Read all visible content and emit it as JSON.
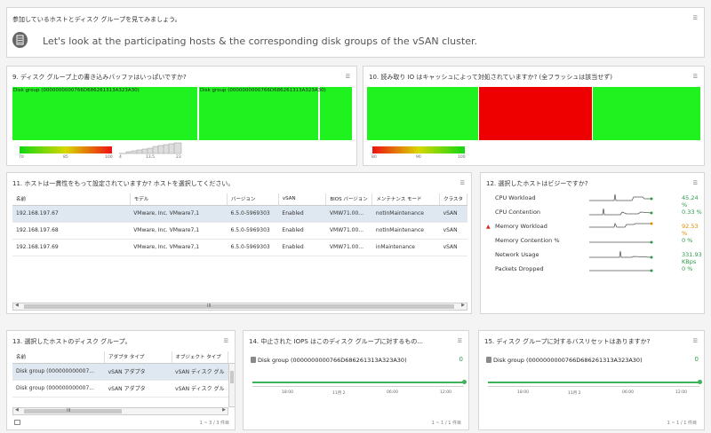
{
  "intro": {
    "title": "参加しているホストとディスク グループを見てみましょう。",
    "text": "Let's look at the participating hosts & the corresponding disk groups of the vSAN cluster."
  },
  "w9": {
    "title": "9. ディスク グループ上の書き込みバッファはいっぱいですか?",
    "groups": [
      "Disk group (0000000000766D686261313A323A30)",
      "Disk group (0000000000766D686261313A323A30)"
    ],
    "ticks": [
      "70",
      "85",
      "100"
    ],
    "hist_ticks": [
      "4",
      "13.5",
      "23"
    ]
  },
  "w10": {
    "title": "10. 読み取り IO はキャッシュによって対処されていますか? (全フラッシュは該当せず)",
    "ticks": [
      "80",
      "90",
      "100"
    ]
  },
  "w11": {
    "title": "11. ホストは一貫性をもって設定されていますか? ホストを選択してください。",
    "columns": [
      "名前",
      "モデル",
      "バージョン",
      "vSAN",
      "BIOS バージョン",
      "メンテナンス モード",
      "クラスタ"
    ],
    "rows": [
      [
        "192.168.197.67",
        "VMware, Inc. VMware7,1",
        "6.5.0-5969303",
        "Enabled",
        "VMW71.00...",
        "notInMaintenance",
        "vSAN"
      ],
      [
        "192.168.197.68",
        "VMware, Inc. VMware7,1",
        "6.5.0-5969303",
        "Enabled",
        "VMW71.00...",
        "notInMaintenance",
        "vSAN"
      ],
      [
        "192.168.197.69",
        "VMware, Inc. VMware7,1",
        "6.5.0-5969303",
        "Enabled",
        "VMW71.00...",
        "inMaintenance",
        "vSAN"
      ]
    ],
    "scroll_mark": "III"
  },
  "w12": {
    "title": "12. 選択したホストはビジーですか?",
    "metrics": [
      {
        "label": "CPU Workload",
        "value": "45.24 %",
        "color": "#2b9a4c"
      },
      {
        "label": "CPU Contention",
        "value": "0.33 %",
        "color": "#2b9a4c"
      },
      {
        "label": "Memory Workload",
        "value": "92.53 %",
        "color": "#e08a00",
        "warn": true
      },
      {
        "label": "Memory Contention %",
        "value": "0 %",
        "color": "#2b9a4c"
      },
      {
        "label": "Network Usage",
        "value": "331.93 KBps",
        "color": "#2b9a4c"
      },
      {
        "label": "Packets Dropped",
        "value": "0 %",
        "color": "#2b9a4c"
      }
    ]
  },
  "w13": {
    "title": "13. 選択したホストのディスク グループ。",
    "columns": [
      "名前",
      "アダプタ タイプ",
      "オブジェクト タイプ"
    ],
    "rows": [
      [
        "Disk group (000000000007...",
        "vSAN アダプタ",
        "vSAN ディスク グル"
      ],
      [
        "Disk group (000000000007...",
        "vSAN アダプタ",
        "vSAN ディスク グル"
      ]
    ],
    "footer": "1 ~ 3 / 3 件目",
    "scroll_mark": "III"
  },
  "w14": {
    "title": "14. 中止された IOPS はこのディスク グループに対するもの...",
    "group": "Disk group (0000000000766D686261313A323A30)",
    "value": "0",
    "times": [
      "18:00",
      "11月 2",
      "06:00",
      "12:00"
    ],
    "footer": "1 ~ 1 / 1 件目"
  },
  "w15": {
    "title": "15. ディスク グループに対するバスリセットはありますか?",
    "group": "Disk group (0000000000766D686261313A323A30)",
    "value": "0",
    "times": [
      "18:00",
      "11月 2",
      "06:00",
      "12:00"
    ],
    "footer": "1 ~ 1 / 1 件目"
  }
}
